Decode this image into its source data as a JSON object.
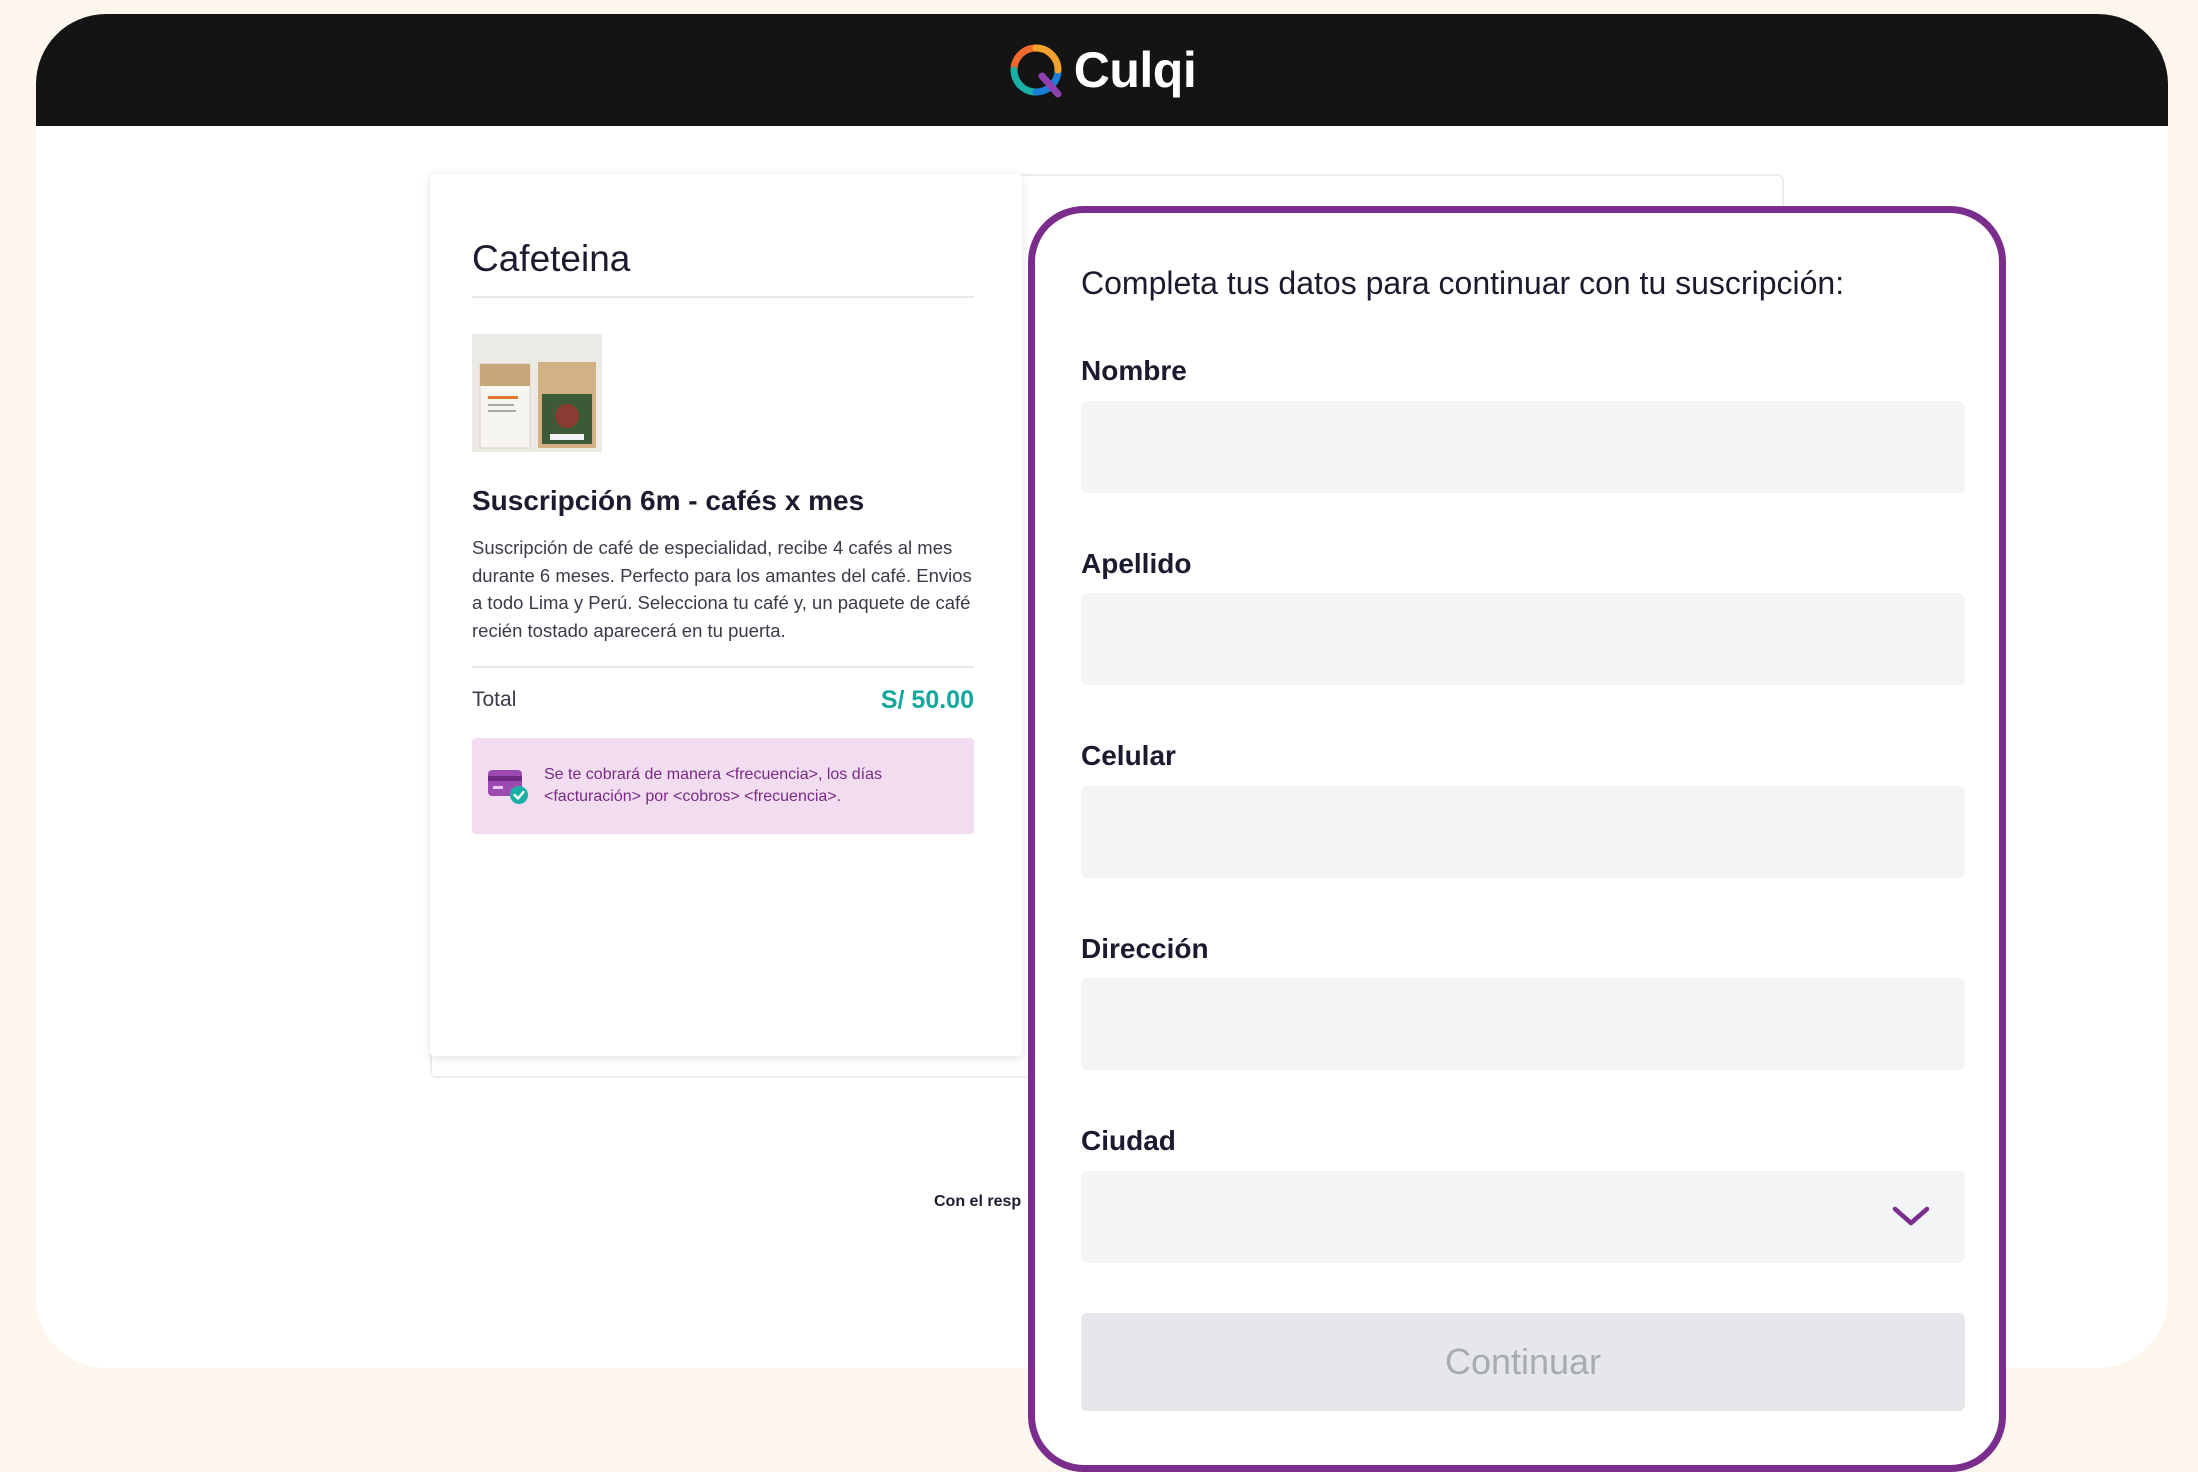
{
  "header": {
    "brand_name": "Culqi"
  },
  "summary": {
    "merchant_name": "Cafeteina",
    "product_title": "Suscripción 6m - cafés x mes",
    "product_description": "Suscripción de café de especialidad, recibe 4 cafés al mes durante 6 meses. Perfecto para los amantes del café. Envios a todo Lima y Perú. Selecciona tu café y, un paquete de café recién tostado aparecerá en tu puerta.",
    "total_label": "Total",
    "total_amount": "S/ 50.00",
    "billing_notice": "Se te cobrará de manera <frecuencia>, los días <facturación> por <cobros> <frecuencia>."
  },
  "footer": {
    "partial_text": "Con el resp"
  },
  "form": {
    "title": "Completa tus datos para continuar con tu suscripción:",
    "fields": {
      "nombre": {
        "label": "Nombre",
        "value": ""
      },
      "apellido": {
        "label": "Apellido",
        "value": ""
      },
      "celular": {
        "label": "Celular",
        "value": ""
      },
      "direccion": {
        "label": "Dirección",
        "value": ""
      },
      "ciudad": {
        "label": "Ciudad",
        "value": ""
      }
    },
    "submit_label": "Continuar"
  },
  "colors": {
    "header_bg": "#141414",
    "accent_purple": "#7b2d8e",
    "total_teal": "#13a89e",
    "notice_bg": "#f2dcef",
    "page_bg": "#fdf6ec"
  },
  "icons": [
    "culqi-logo-icon",
    "credit-card-check-icon",
    "chevron-down-icon"
  ]
}
